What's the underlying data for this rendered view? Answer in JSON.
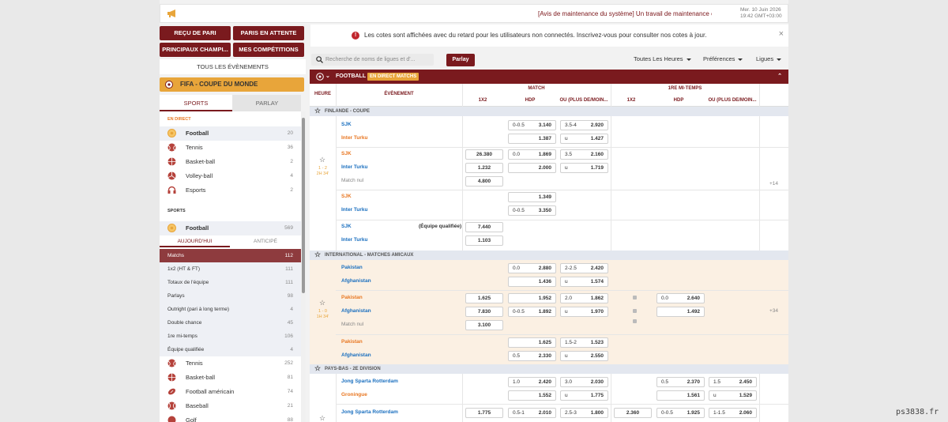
{
  "topbar": {
    "ticker": "[Avis de maintenance du système] Un travail de maintenance ess",
    "date": "Mer. 10 Juin 2026",
    "time": "19:42 GMT+03:00"
  },
  "nav": {
    "receipt": "REÇU DE PARI",
    "pending": "PARIS EN ATTENTE",
    "main": "PRINCIPAUX CHAMPI...",
    "mine": "MES COMPÉTITIONS",
    "all_events": "TOUS LES ÉVÈNEMENTS"
  },
  "featured": {
    "label": "FIFA - COUPE DU MONDE"
  },
  "sidebar": {
    "tabs": [
      "SPORTS",
      "PARLAY"
    ],
    "live_header": "EN DIRECT",
    "live": [
      {
        "label": "Football",
        "count": "20"
      },
      {
        "label": "Tennis",
        "count": "36"
      },
      {
        "label": "Basket-ball",
        "count": "2"
      },
      {
        "label": "Volley-ball",
        "count": "4"
      },
      {
        "label": "Esports",
        "count": "2"
      }
    ],
    "sports_header": "SPORTS",
    "football": {
      "label": "Football",
      "count": "569"
    },
    "subtabs": [
      "AUJOURD'HUI",
      "ANTICIPÉ"
    ],
    "markets": [
      {
        "label": "Matchs",
        "count": "112"
      },
      {
        "label": "1x2 (HT & FT)",
        "count": "111"
      },
      {
        "label": "Totaux de l'équipe",
        "count": "111"
      },
      {
        "label": "Parlays",
        "count": "98"
      },
      {
        "label": "Outright (pari à long terme)",
        "count": "4"
      },
      {
        "label": "Double chance",
        "count": "45"
      },
      {
        "label": "1re mi-temps",
        "count": "106"
      },
      {
        "label": "Équipe qualifiée",
        "count": "4"
      }
    ],
    "sports": [
      {
        "label": "Tennis",
        "count": "252"
      },
      {
        "label": "Basket-ball",
        "count": "81"
      },
      {
        "label": "Football américain",
        "count": "74"
      },
      {
        "label": "Baseball",
        "count": "21"
      },
      {
        "label": "Golf",
        "count": "88"
      }
    ]
  },
  "alert": {
    "message": "Les cotes sont affichées avec du retard pour les utilisateurs non connectés. Inscrivez-vous pour consulter nos cotes à jour."
  },
  "toolbar": {
    "search_placeholder": "Recherche de noms de ligues et d'...",
    "parlay": "Parlay",
    "hours": "Toutes Les Heures",
    "prefs": "Préférences",
    "leagues": "Ligues"
  },
  "table": {
    "sport": "FOOTBALL",
    "live_badge": "EN DIRECT MATCHS",
    "headers": {
      "time": "HEURE",
      "event": "ÉVÈNEMENT",
      "match": "MATCH",
      "half": "1RE MI-TEMPS",
      "x12": "1X2",
      "hdp": "HDP",
      "ou": "OU (PLUS DE/MOIN..."
    },
    "leagues": [
      "FINLANDE - COUPE",
      "INTERNATIONAL - MATCHES AMICAUX",
      "PAYS-BAS - 2E DIVISION"
    ],
    "m1": {
      "score": "1 - 2",
      "clock": "2H 34'",
      "more": "+14",
      "t1": "SJK",
      "t2": "Inter Turku",
      "draw": "Match nul",
      "qual": "(Équipe qualifiée)",
      "r1": {
        "h1": "0-0.5",
        "v1": "3.140",
        "h2": "3.5-4",
        "v2": "2.920"
      },
      "r2": {
        "v1": "1.387",
        "h2": "u",
        "v2": "1.427"
      },
      "b2": {
        "x1": "26.380",
        "x2": "1.232",
        "x3": "4.800",
        "h1": "0.0",
        "v1": "1.869",
        "h2": "3.5",
        "v2": "2.160",
        "h3": "u",
        "v3": "1.719",
        "v4": "2.000"
      },
      "b3": {
        "v1": "1.349",
        "h2": "0-0.5",
        "v2": "3.350"
      },
      "b4": {
        "x1": "7.440",
        "x2": "1.103"
      }
    },
    "m2": {
      "score": "1 - 0",
      "clock": "1H 34'",
      "more": "+34",
      "t1": "Pakistan",
      "t2": "Afghanistan",
      "draw": "Match nul",
      "b1": {
        "h1": "0.0",
        "v1": "2.880",
        "h2": "2-2.5",
        "v2": "2.420",
        "v3": "1.436",
        "h4": "u",
        "v4": "1.574"
      },
      "b2": {
        "x1": "1.625",
        "x2": "7.830",
        "x3": "3.100",
        "v1": "1.952",
        "h2": "0-0.5",
        "v2": "1.892",
        "h3": "2.0",
        "v3": "1.862",
        "h4": "u",
        "v4": "1.970",
        "hh1": "0.0",
        "hv1": "2.640",
        "hv2": "1.492"
      },
      "b3": {
        "v1": "1.625",
        "h2": "1.5-2",
        "v2": "1.523",
        "h3": "0.5",
        "v3": "2.330",
        "h4": "u",
        "v4": "2.550"
      }
    },
    "m3": {
      "t1": "Jong Sparta Rotterdam",
      "t2": "Groningue",
      "b1": {
        "h1": "1.0",
        "v1": "2.420",
        "h2": "3.0",
        "v2": "2.030",
        "v3": "1.552",
        "h4": "u",
        "v4": "1.775",
        "hh1": "0.5",
        "hv1": "2.370",
        "hh2": "1.5",
        "hv2": "2.450",
        "hv3": "1.561",
        "hh4": "u",
        "hv4": "1.529"
      },
      "b2": {
        "x1": "1.775",
        "h1": "0.5-1",
        "v1": "2.010",
        "h2": "2.5-3",
        "v2": "1.800",
        "hx": "2.360",
        "hh1": "0-0.5",
        "hv1": "1.925",
        "hh2": "1-1.5",
        "hv2": "2.060"
      }
    }
  },
  "watermark": "ps3838.fr",
  "colors": {
    "brand": "#7a1a1e",
    "accent": "#e8a53a",
    "team_home": "#1a6fbf",
    "team_fav": "#e87722"
  }
}
